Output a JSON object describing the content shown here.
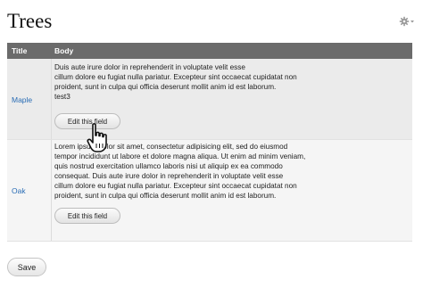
{
  "page": {
    "title": "Trees"
  },
  "settings_icon": "gear-icon",
  "table": {
    "columns": [
      "Title",
      "Body"
    ],
    "rows": [
      {
        "title": "Maple",
        "body_lines": [
          "Duis aute irure dolor in reprehenderit in voluptate velit esse",
          "cillum dolore eu fugiat nulla pariatur. Excepteur sint occaecat cupidatat non",
          "proident, sunt in culpa qui officia deserunt mollit anim id est laborum.",
          "test3"
        ],
        "edit_label": "Edit this field"
      },
      {
        "title": "Oak",
        "body_lines": [
          "Lorem ipsum dolor sit amet, consectetur adipisicing elit, sed do eiusmod",
          "tempor incididunt ut labore et dolore magna aliqua. Ut enim ad minim veniam,",
          "quis nostrud exercitation ullamco laboris nisi ut aliquip ex ea commodo",
          "consequat. Duis aute irure dolor in reprehenderit in voluptate velit esse",
          "cillum dolore eu fugiat nulla pariatur. Excepteur sint occaecat cupidatat non",
          "proident, sunt in culpa qui officia deserunt mollit anim id est laborum."
        ],
        "edit_label": "Edit this field"
      }
    ]
  },
  "save_label": "Save",
  "cursor_icon": "hand-pointer-icon"
}
